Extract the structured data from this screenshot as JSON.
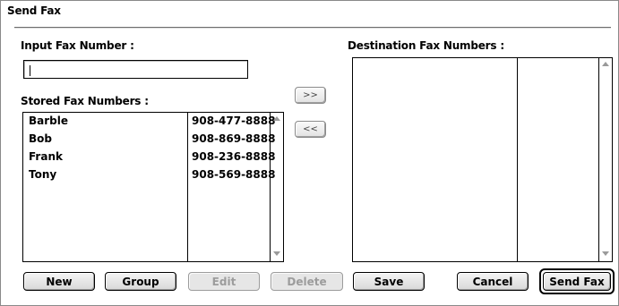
{
  "dialog": {
    "title": "Send Fax"
  },
  "input_section": {
    "label": "Input Fax Number :",
    "value": ""
  },
  "stored_section": {
    "label": "Stored Fax Numbers :",
    "entries": [
      {
        "name": "Barble",
        "number": "908-477-8888"
      },
      {
        "name": "Bob",
        "number": "908-869-8888"
      },
      {
        "name": "Frank",
        "number": "908-236-8888"
      },
      {
        "name": "Tony",
        "number": "908-569-8888"
      }
    ]
  },
  "destination_section": {
    "label": "Destination Fax Numbers :",
    "entries": []
  },
  "transfer_buttons": {
    "add": ">>",
    "remove": "<<"
  },
  "buttons": {
    "new": "New",
    "group": "Group",
    "edit": "Edit",
    "delete": "Delete",
    "save": "Save",
    "cancel": "Cancel",
    "send_fax": "Send Fax"
  },
  "states": {
    "edit_enabled": false,
    "delete_enabled": false
  }
}
